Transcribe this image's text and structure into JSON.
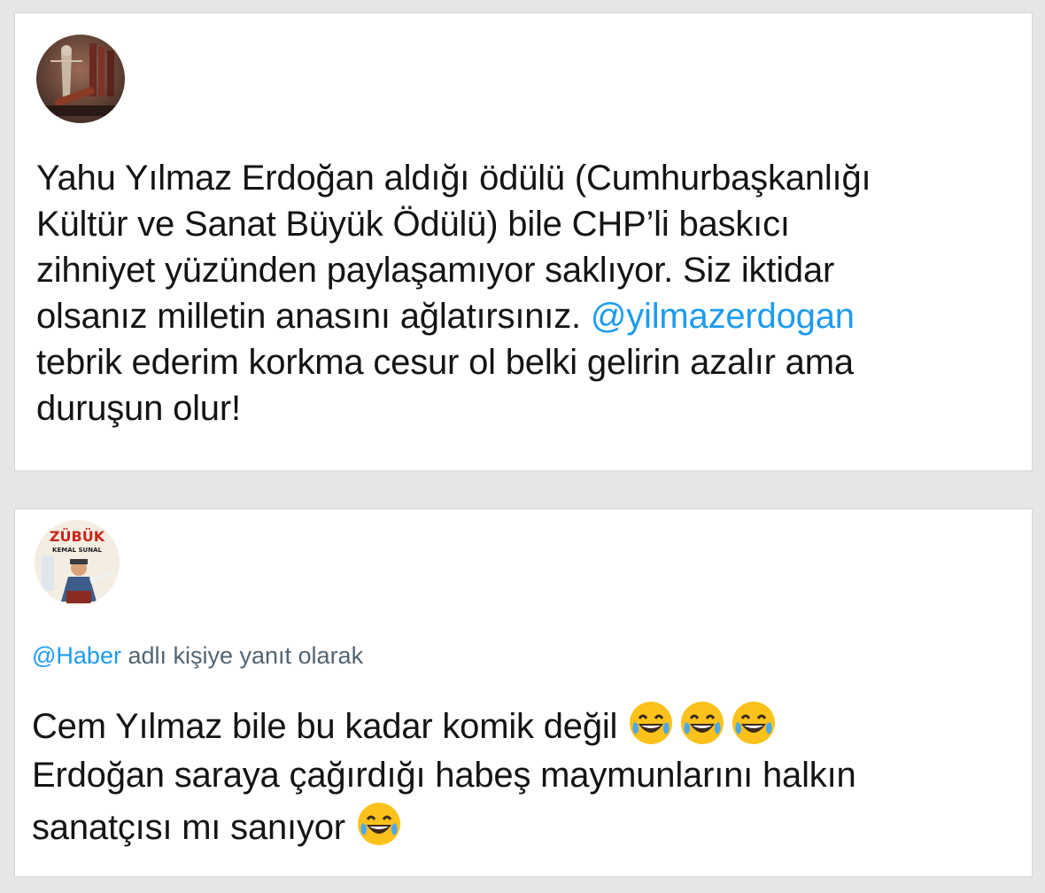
{
  "tweet1": {
    "avatar_icon": "justice-gavel-avatar",
    "text_lines": [
      "Yahu Yılmaz Erdoğan aldığı ödülü (Cumhurbaşkanlığı",
      "Kültür ve Sanat Büyük Ödülü) bile CHP’li baskıcı",
      "zihniyet yüzünden paylaşamıyor saklıyor. Siz iktidar"
    ],
    "line4_prefix": "olsanız milletin anasını ağlatırsınız. ",
    "line4_mention": "@yilmazerdogan",
    "text_lines_end": [
      "tebrik ederim korkma cesur ol belki gelirin azalır ama",
      "duruşun olur!"
    ]
  },
  "tweet2": {
    "avatar_icon": "movie-poster-avatar",
    "avatar_poster_title": "ZÜBÜK",
    "avatar_poster_subtitle": "KEMAL SUNAL",
    "reply_mention": "@Haber",
    "reply_suffix": " adlı kişiye yanıt olarak",
    "line1": "Cem Yılmaz bile bu kadar komik değil ",
    "line2": "Erdoğan saraya çağırdığı habeş maymunlarını halkın",
    "line3": "sanatçısı mı sanıyor ",
    "emoji": "face-with-tears-of-joy-icon"
  },
  "colors": {
    "mention": "#1d9bf0",
    "secondary_text": "#536471",
    "page_background": "#e6e6e6"
  }
}
